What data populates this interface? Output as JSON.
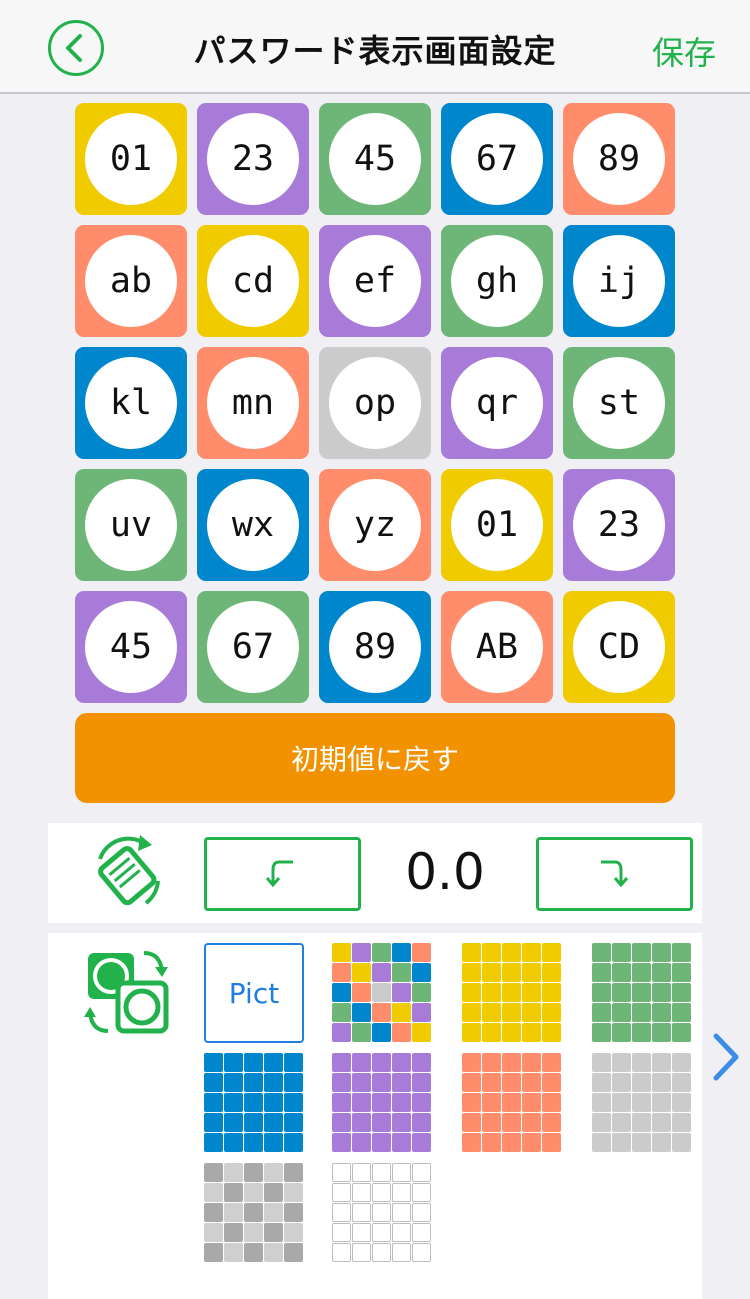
{
  "header": {
    "title": "パスワード表示画面設定",
    "save_label": "保存"
  },
  "colors": {
    "yellow": "#f0cb00",
    "purple": "#a87bd9",
    "green": "#6db678",
    "blue": "#0086cc",
    "salmon": "#ff8c6b",
    "gray": "#cbcbcb",
    "accent": "#21b24b",
    "orange": "#f29200",
    "link": "#1f7fe0"
  },
  "grid": {
    "tiles": [
      {
        "label": "01",
        "color": "yellow"
      },
      {
        "label": "23",
        "color": "purple"
      },
      {
        "label": "45",
        "color": "green"
      },
      {
        "label": "67",
        "color": "blue"
      },
      {
        "label": "89",
        "color": "salmon"
      },
      {
        "label": "ab",
        "color": "salmon"
      },
      {
        "label": "cd",
        "color": "yellow"
      },
      {
        "label": "ef",
        "color": "purple"
      },
      {
        "label": "gh",
        "color": "green"
      },
      {
        "label": "ij",
        "color": "blue"
      },
      {
        "label": "kl",
        "color": "blue"
      },
      {
        "label": "mn",
        "color": "salmon"
      },
      {
        "label": "op",
        "color": "gray"
      },
      {
        "label": "qr",
        "color": "purple"
      },
      {
        "label": "st",
        "color": "green"
      },
      {
        "label": "uv",
        "color": "green"
      },
      {
        "label": "wx",
        "color": "blue"
      },
      {
        "label": "yz",
        "color": "salmon"
      },
      {
        "label": "01",
        "color": "yellow"
      },
      {
        "label": "23",
        "color": "purple"
      },
      {
        "label": "45",
        "color": "purple"
      },
      {
        "label": "67",
        "color": "green"
      },
      {
        "label": "89",
        "color": "blue"
      },
      {
        "label": "AB",
        "color": "salmon"
      },
      {
        "label": "CD",
        "color": "yellow"
      }
    ]
  },
  "reset_label": "初期値に戻す",
  "rotation": {
    "value": "0.0",
    "icon": "rotate-tile-icon",
    "left_icon": "rotate-counterclockwise-icon",
    "right_icon": "rotate-clockwise-icon"
  },
  "patterns": {
    "icon": "swap-pattern-icon",
    "pict_label": "Pict",
    "next_icon": "chevron-right-icon",
    "items": [
      {
        "name": "pattern-mixed",
        "cells": [
          "yellow",
          "purple",
          "green",
          "blue",
          "salmon",
          "salmon",
          "yellow",
          "purple",
          "green",
          "blue",
          "blue",
          "salmon",
          "gray",
          "purple",
          "green",
          "green",
          "blue",
          "salmon",
          "yellow",
          "purple",
          "purple",
          "green",
          "blue",
          "salmon",
          "yellow"
        ]
      },
      {
        "name": "pattern-yellow",
        "fill": "yellow"
      },
      {
        "name": "pattern-green",
        "fill": "green"
      },
      {
        "name": "pattern-blue",
        "fill": "blue"
      },
      {
        "name": "pattern-purple",
        "fill": "purple"
      },
      {
        "name": "pattern-salmon",
        "fill": "salmon"
      },
      {
        "name": "pattern-gray",
        "fill": "gray"
      },
      {
        "name": "pattern-checker",
        "checker": [
          "#a9a9a9",
          "#cfcfcf"
        ]
      },
      {
        "name": "pattern-white",
        "fill": "white"
      }
    ]
  }
}
